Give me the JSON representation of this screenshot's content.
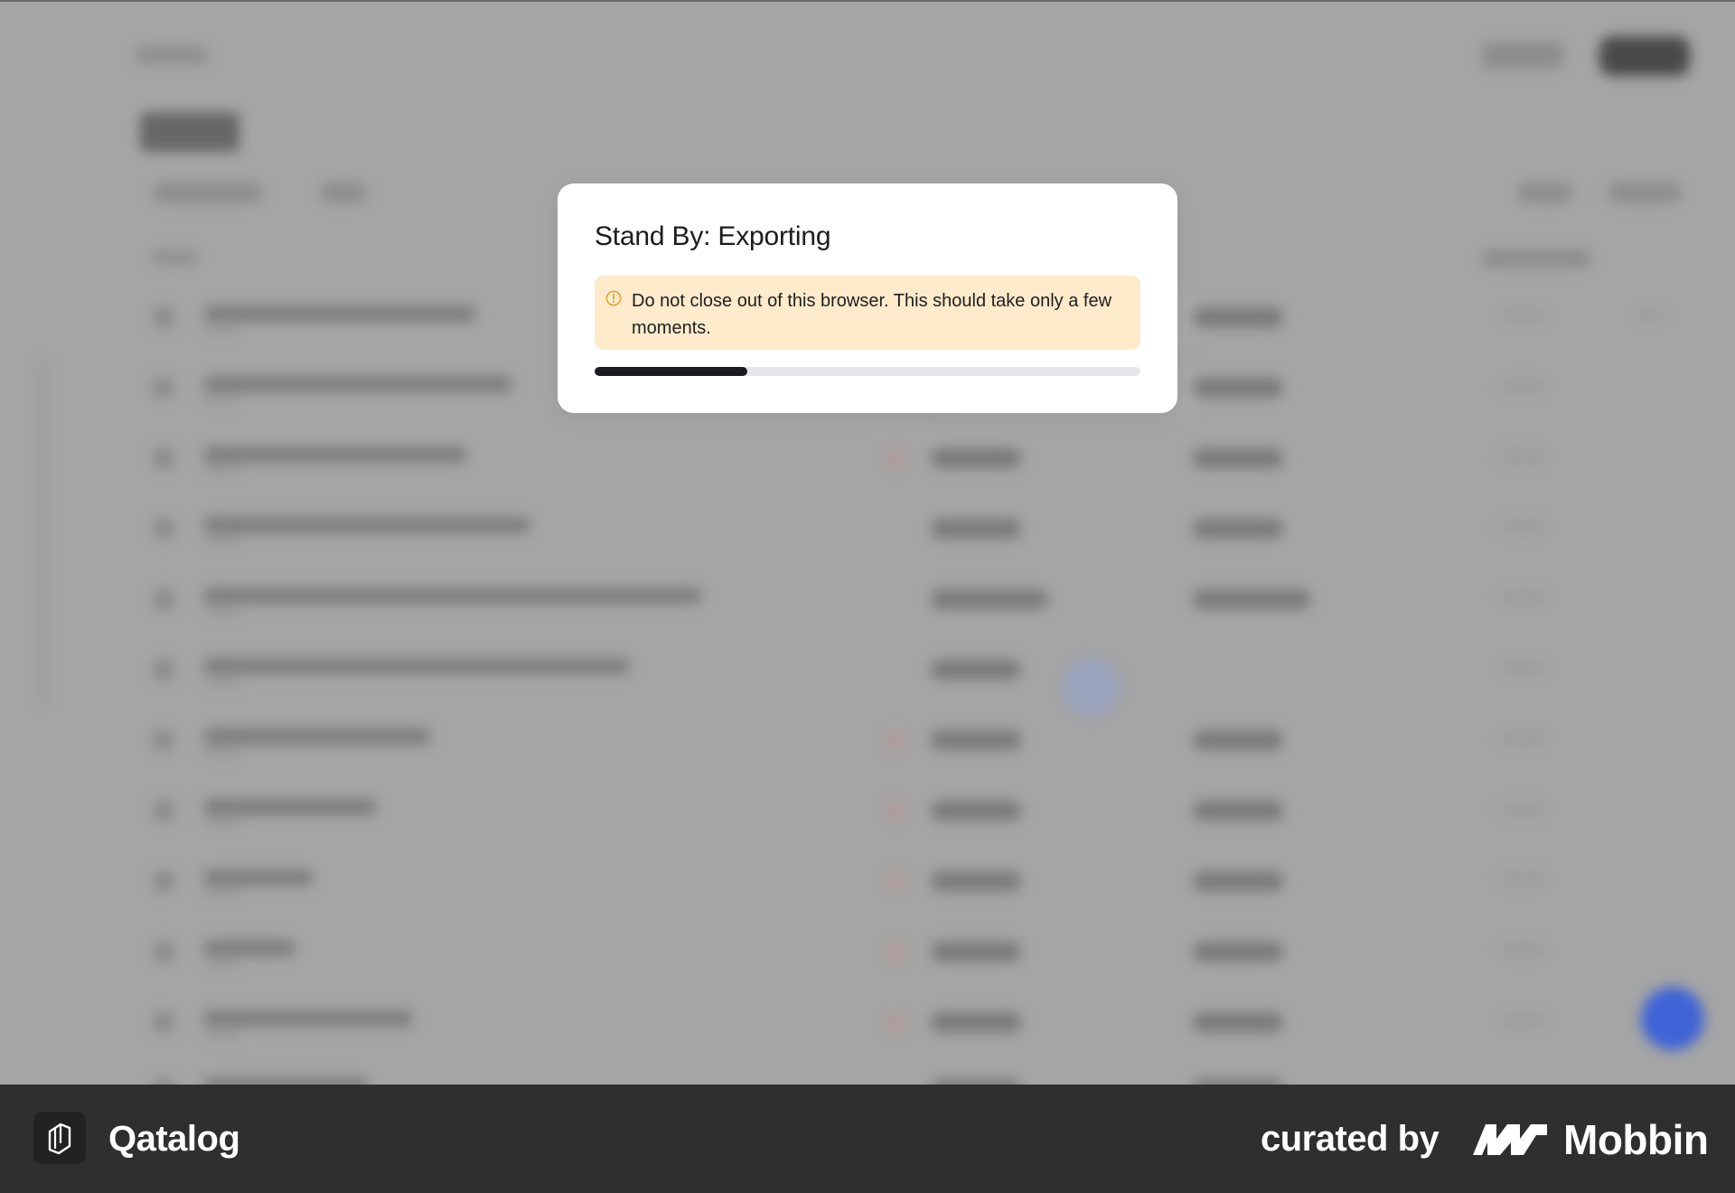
{
  "modal": {
    "title": "Stand By: Exporting",
    "alert_text": "Do not close out of this browser. This should take only a few moments.",
    "progress_fraction": 0.28
  },
  "footer": {
    "brand_name": "Qatalog",
    "curated_label": "curated by",
    "mobbin_name": "Mobbin"
  },
  "colors": {
    "overlay": "#a3a3a3",
    "alert_bg": "#fdebcb",
    "alert_icon": "#e0a638",
    "progress_fill": "#1c1c1e",
    "progress_track": "#e6e6ea",
    "footer_bg": "#2f2f2f",
    "fab": "#3f63d6"
  },
  "icons": {
    "alert": "exclamation-circle-icon",
    "brand": "qatalog-logo-icon",
    "mobbin": "mobbin-logo-icon"
  }
}
